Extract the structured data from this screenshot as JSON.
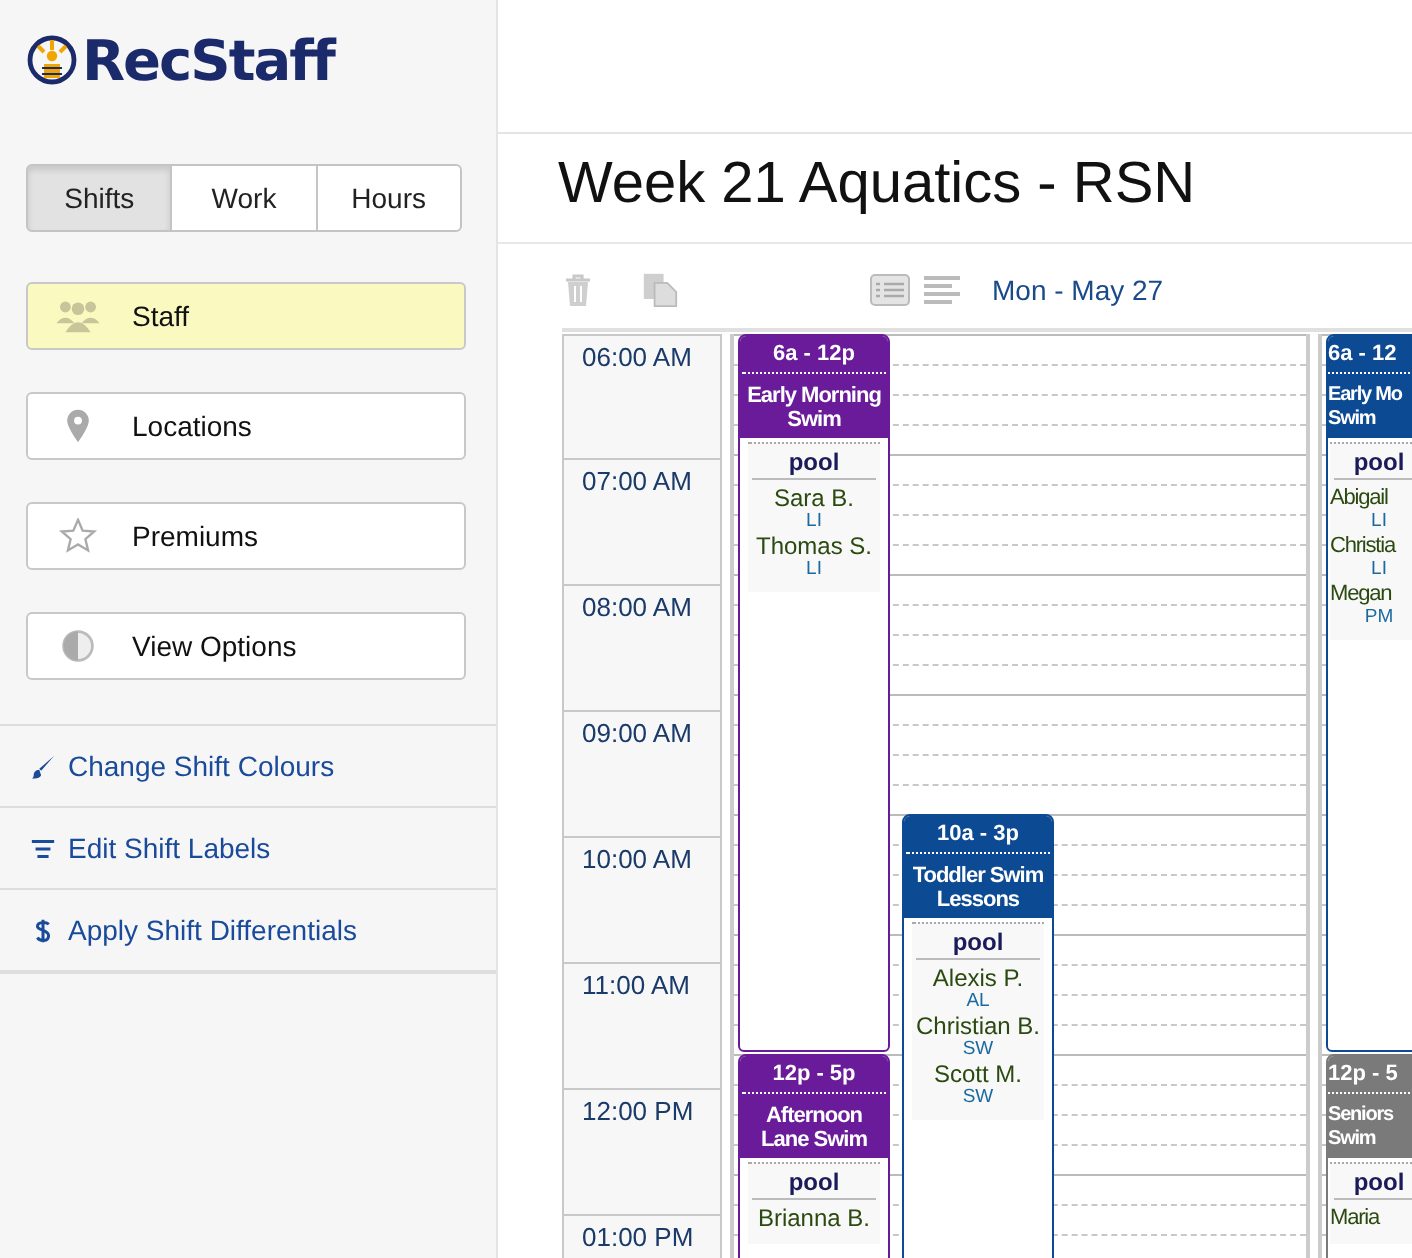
{
  "app": {
    "name": "RecStaff"
  },
  "sidebar": {
    "tabs": [
      {
        "label": "Shifts",
        "selected": true
      },
      {
        "label": "Work",
        "selected": false
      },
      {
        "label": "Hours",
        "selected": false
      }
    ],
    "filters": [
      {
        "label": "Staff",
        "kind": "staff",
        "selected": true
      },
      {
        "label": "Locations",
        "kind": "locations",
        "selected": false
      },
      {
        "label": "Premiums",
        "kind": "premiums",
        "selected": false
      },
      {
        "label": "View Options",
        "kind": "view",
        "selected": false
      }
    ],
    "links": [
      {
        "label": "Change Shift Colours",
        "kind": "brush"
      },
      {
        "label": "Edit Shift Labels",
        "kind": "labels"
      },
      {
        "label": "Apply Shift Differentials",
        "kind": "dollar"
      }
    ]
  },
  "page": {
    "title": "Week 21 Aquatics - RSN",
    "date": "Mon - May 27"
  },
  "calendar": {
    "hours": [
      "06:00 AM",
      "07:00 AM",
      "08:00 AM",
      "09:00 AM",
      "10:00 AM",
      "11:00 AM",
      "12:00 PM",
      "01:00 PM"
    ],
    "days": [
      {
        "events": [
          {
            "time": "6a - 12p",
            "title": "Early Morning Swim",
            "color": "#6a1b9a",
            "location": "pool",
            "staff": [
              {
                "name": "Sara B.",
                "role": "LI"
              },
              {
                "name": "Thomas S.",
                "role": "LI"
              }
            ]
          },
          {
            "time": "10a - 3p",
            "title": "Toddler Swim Lessons",
            "color": "#0d4a94",
            "location": "pool",
            "staff": [
              {
                "name": "Alexis P.",
                "role": "AL"
              },
              {
                "name": "Christian B.",
                "role": "SW"
              },
              {
                "name": "Scott M.",
                "role": "SW"
              }
            ]
          },
          {
            "time": "12p - 5p",
            "title": "Afternoon Lane Swim",
            "color": "#6a1b9a",
            "location": "pool",
            "staff": [
              {
                "name": "Brianna B."
              }
            ]
          }
        ]
      },
      {
        "events": [
          {
            "time": "6a - 12",
            "title": "Early Mo Swim",
            "color": "#0d4a94",
            "location": "pool",
            "staff": [
              {
                "name": "Abigail",
                "role": "LI"
              },
              {
                "name": "Christia",
                "role": "LI"
              },
              {
                "name": "Megan",
                "role": "PM"
              }
            ]
          },
          {
            "time": "12p - 5",
            "title": "Seniors Swim",
            "color": "#7a7a7a",
            "location": "pool",
            "staff": [
              {
                "name": "Maria"
              }
            ]
          }
        ]
      }
    ]
  }
}
